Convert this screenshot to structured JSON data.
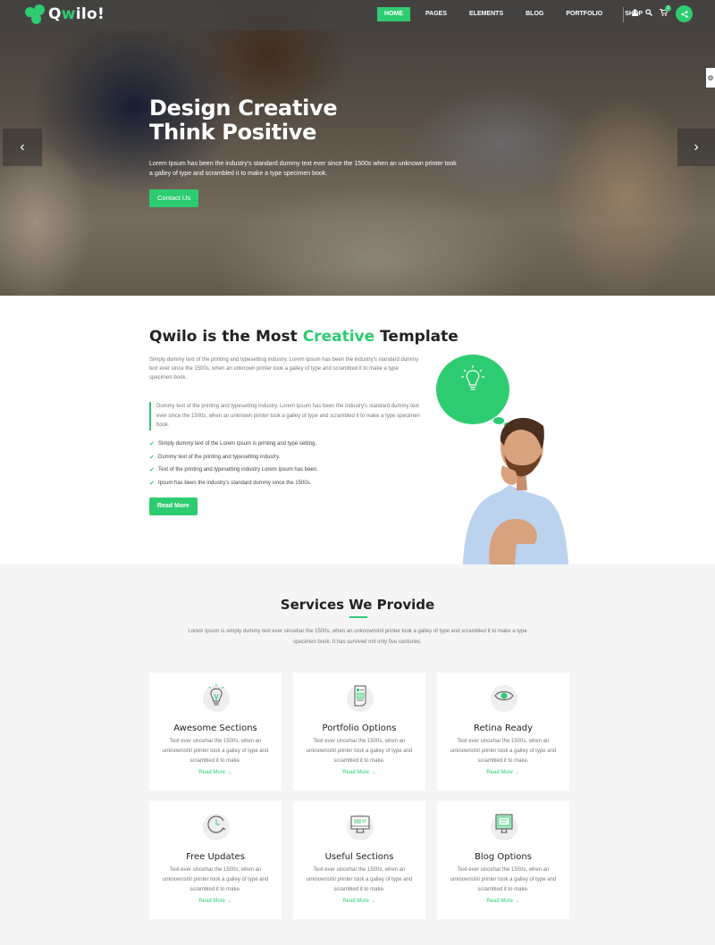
{
  "brand": {
    "name_pre": "Q",
    "name_accent": "w",
    "name_post": "ilo!",
    "accent_color": "#2ecc71"
  },
  "nav": {
    "items": [
      {
        "label": "HOME",
        "active": true
      },
      {
        "label": "PAGES",
        "active": false
      },
      {
        "label": "ELEMENTS",
        "active": false
      },
      {
        "label": "BLOG",
        "active": false
      },
      {
        "label": "PORTFOLIO",
        "active": false
      },
      {
        "label": "SHOP",
        "active": false
      }
    ],
    "user_icon": "user-icon",
    "search_icon": "search-icon",
    "cart_icon": "cart-icon",
    "cart_count": "2",
    "share_icon": "share-icon"
  },
  "hero": {
    "title_line1": "Design Creative",
    "title_line2": "Think Positive",
    "text": "Lorem Ipsum has been the industry's standard dummy text ever since the 1500s when an unknown printer took a galley of type and scrambled it to make a type specimen book.",
    "button_label": "Contact Us",
    "prev_arrow": "‹",
    "next_arrow": "›"
  },
  "about": {
    "title_pre": "Qwilo is the Most ",
    "title_highlight": "Creative",
    "title_post": " Template",
    "paragraph": "Simply dummy text of the printing and typesetting industry. Lorem Ipsum has been the industry's standard dummy text ever since the 1500s, when an unknown printer took a galley of type and scrambled it to make a type specimen book.",
    "quote": "Dummy text of the printing and typesetting industry. Lorem Ipsum has been the industry's standard dummy text ever since the 1500s, when an unknown printer took a galley of type and scrambled it to make a type specimen book.",
    "checklist": [
      "Simply dummy text of the Lorem Ipsum is printing and type setting.",
      "Dummy text of the printing and typesetting industry.",
      "Text of the printing and typesetting industry Lorem Ipsum has been.",
      "Ipsum has been the industry's standard dummy since the 1500s."
    ],
    "button_label": "Read More"
  },
  "services": {
    "title": "Services We Provide",
    "subtitle": "Lorem Ipsum is simply dummy text ever sincehar the 1500s, when an unknownshil printer took a galley of type and scrambled it to make a type specimen book. It has survived not only five centuries.",
    "cards": [
      {
        "icon": "lightbulb-icon",
        "title": "Awesome Sections",
        "text": "Text ever sincehar the 1500s, when an unknownshil printer took a galley of type and scrambled it to make.",
        "link": "Read More →"
      },
      {
        "icon": "document-icon",
        "title": "Portfolio Options",
        "text": "Text ever sincehar the 1500s, when an unknownshil printer took a galley of type and scrambled it to make.",
        "link": "Read More →"
      },
      {
        "icon": "eye-icon",
        "title": "Retina Ready",
        "text": "Text ever sincehar the 1500s, when an unknownshil printer took a galley of type and scrambled it to make.",
        "link": "Read More →"
      },
      {
        "icon": "clock-refresh-icon",
        "title": "Free Updates",
        "text": "Text ever sincehar the 1500s, when an unknownshil printer took a galley of type and scrambled it to make.",
        "link": "Read More →"
      },
      {
        "icon": "monitor-icon",
        "title": "Useful Sections",
        "text": "Text ever sincehar the 1500s, when an unknownshil printer took a galley of type and scrambled it to make.",
        "link": "Read More →"
      },
      {
        "icon": "monitor-blog-icon",
        "title": "Blog Options",
        "text": "Text ever sincehar the 1500s, when an unknownshil printer took a galley of type and scrambled it to make.",
        "link": "Read More →"
      }
    ]
  }
}
